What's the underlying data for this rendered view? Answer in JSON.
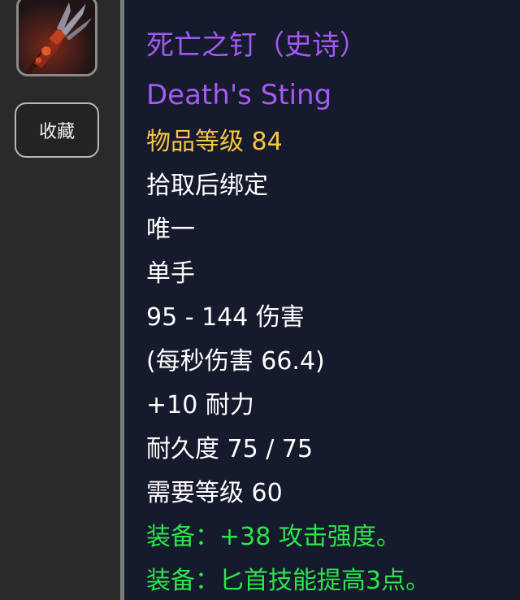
{
  "sidebar": {
    "favorite_label": "收藏"
  },
  "item": {
    "icon": "trident-icon",
    "name_cn": "死亡之钉（史诗）",
    "name_en": "Death's Sting",
    "item_level": "物品等级 84",
    "bind": "拾取后绑定",
    "unique": "唯一",
    "slot": "单手",
    "damage": "95 - 144 伤害",
    "dps": "(每秒伤害 66.4)",
    "stamina": "+10 耐力",
    "durability": "耐久度 75 / 75",
    "required_level": "需要等级 60",
    "equip_effects": [
      "装备：+38 攻击强度。",
      "装备：匕首技能提高3点。"
    ]
  },
  "colors": {
    "epic": "#a35af2",
    "item_level": "#f7c542",
    "equip": "#2be64b",
    "text": "#ffffff",
    "tooltip_bg": "#161a2d",
    "sidebar_bg": "#2a2a2a"
  }
}
